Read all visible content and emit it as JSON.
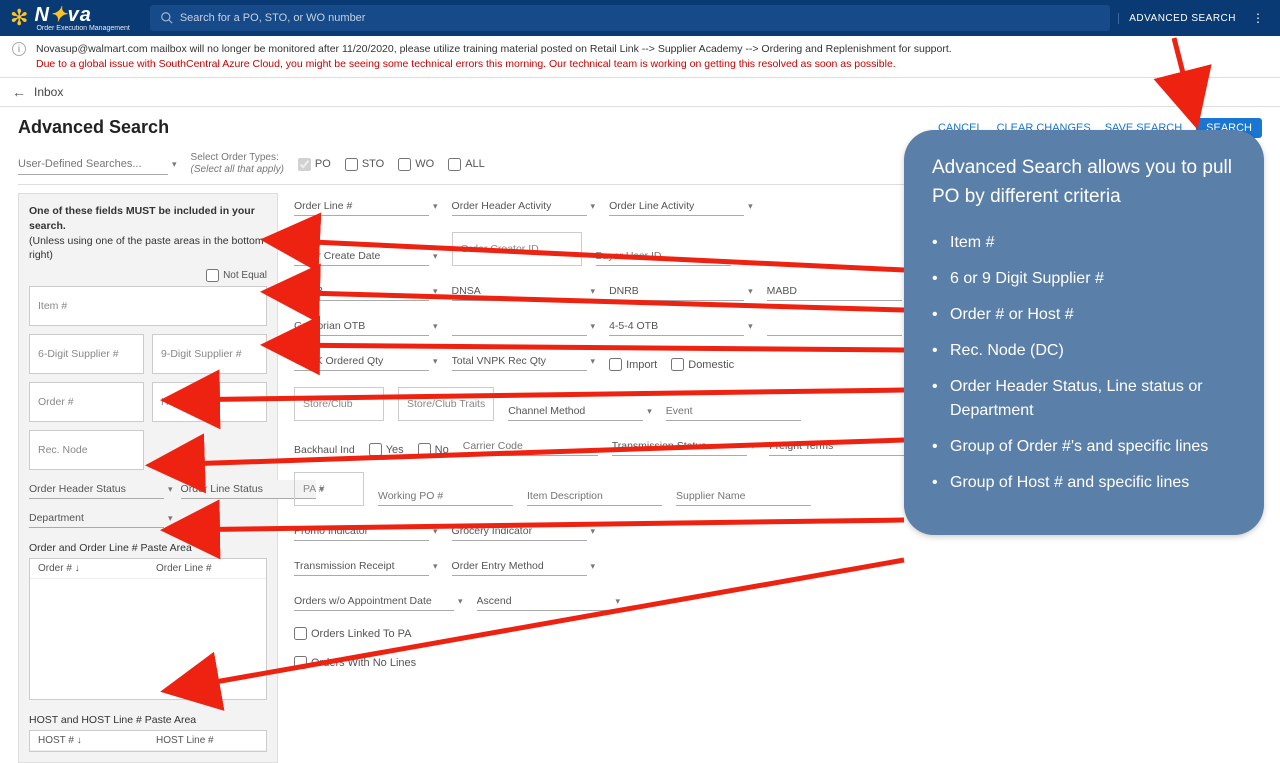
{
  "header": {
    "logo_main": "N",
    "logo_rest": "va",
    "logo_sub": "Order Execution Management",
    "search_placeholder": "Search for a PO, STO, or WO number",
    "advanced_link": "ADVANCED SEARCH"
  },
  "notice": {
    "line1": "Novasup@walmart.com mailbox will no longer be monitored after 11/20/2020, please utilize training material posted on Retail Link --> Supplier Academy --> Ordering and Replenishment for support.",
    "line2": "Due to a global issue with SouthCentral Azure Cloud, you might be seeing some technical errors this morning. Our technical team is working on getting this resolved as soon as possible."
  },
  "crumb": {
    "back": "←",
    "inbox": "Inbox"
  },
  "page": {
    "title": "Advanced Search",
    "cancel": "CANCEL",
    "clear": "CLEAR CHANGES",
    "save": "SAVE SEARCH",
    "search": "SEARCH"
  },
  "row2": {
    "uds": "User-Defined Searches...",
    "sot_label": "Select Order Types:",
    "sot_hint": "(Select all that apply)",
    "po": "PO",
    "sto": "STO",
    "wo": "WO",
    "all": "ALL"
  },
  "left": {
    "head_bold": "One of these fields MUST be included in your search.",
    "head_sub": "(Unless using one of the paste areas in the bottom right)",
    "not_equal": "Not Equal",
    "item": "Item #",
    "sup6": "6-Digit Supplier #",
    "sup9": "9-Digit Supplier #",
    "order": "Order #",
    "host": "HOST #",
    "rec": "Rec. Node",
    "ohs": "Order Header Status",
    "ols": "Order Line Status",
    "dept": "Department",
    "paste1_label": "Order and Order Line # Paste Area",
    "paste1_c1": "Order # ↓",
    "paste1_c2": "Order Line #",
    "paste2_label": "HOST and HOST Line # Paste Area",
    "paste2_c1": "HOST # ↓",
    "paste2_c2": "HOST Line #"
  },
  "right": {
    "order_line": "Order Line #",
    "oha": "Order Header Activity",
    "ola": "Order Line Activity",
    "ocd": "Order Create Date",
    "oci": "Order Creator ID",
    "bui": "Buyer User ID",
    "dnsb": "DNSB",
    "dnsa": "DNSA",
    "dnrb": "DNRB",
    "mabd": "MABD",
    "gotb": "Gregorian OTB",
    "f454": "4-5-4 OTB",
    "vnpk": "VNPK Ordered Qty",
    "tvnpk": "Total VNPK Rec Qty",
    "import": "Import",
    "domestic": "Domestic",
    "store": "Store/Club",
    "traits": "Store/Club Traits",
    "channel": "Channel Method",
    "event": "Event",
    "backhaul": "Backhaul Ind",
    "yes": "Yes",
    "no": "No",
    "carrier": "Carrier Code",
    "trans": "Transmission Status",
    "freight": "Freight Terms",
    "pa": "PA #",
    "wpo": "Working PO #",
    "idesc": "Item Description",
    "sname": "Supplier Name",
    "promo": "Promo Indicator",
    "grocery": "Grocery Indicator",
    "treceipt": "Transmission Receipt",
    "oem": "Order Entry Method",
    "owad": "Orders w/o Appointment Date",
    "ascend": "Ascend",
    "oltpa": "Orders Linked To PA",
    "ownl": "Orders With No Lines"
  },
  "overlay": {
    "title": "Advanced Search allows you to pull PO by different criteria",
    "items": [
      "Item #",
      "6 or 9 Digit Supplier #",
      "Order # or Host #",
      "Rec. Node (DC)",
      "Order Header Status, Line status or Department",
      "Group of Order #'s and specific lines",
      "Group of Host # and specific lines"
    ]
  }
}
